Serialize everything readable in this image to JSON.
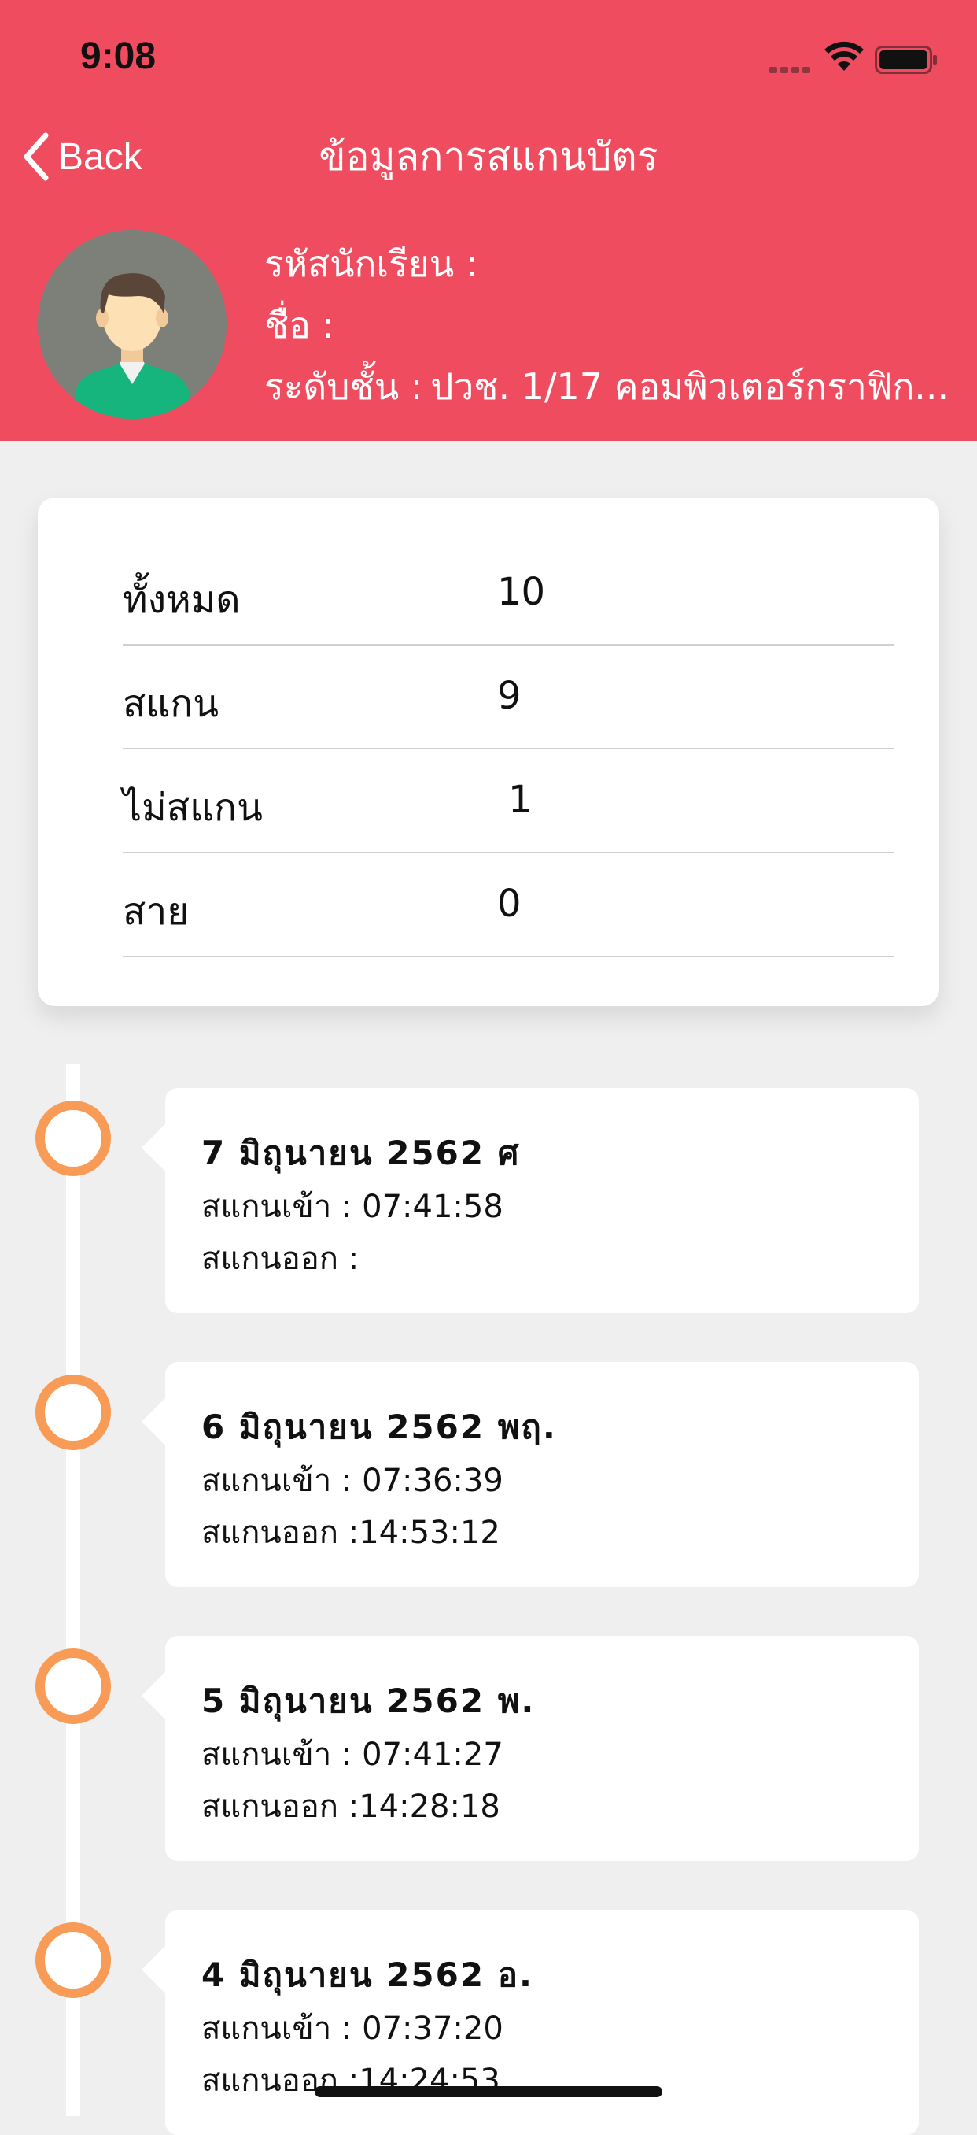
{
  "status_bar": {
    "time": "9:08"
  },
  "nav": {
    "back_label": "Back",
    "title": "ข้อมูลการสแกนบัตร"
  },
  "profile": {
    "student_id_label": "รหัสนักเรียน :",
    "student_id": "",
    "name_label": "ชื่อ :",
    "name": "",
    "level_label": "ระดับชั้น :",
    "level": "ปวช. 1/17 คอมพิวเตอร์กราฟิก..."
  },
  "summary": [
    {
      "label": "ทั้งหมด",
      "value": "10"
    },
    {
      "label": "สแกน",
      "value": "9"
    },
    {
      "label": "ไม่สแกน",
      "value": "1"
    },
    {
      "label": "สาย",
      "value": "0"
    }
  ],
  "entries": [
    {
      "date": "7 มิถุนายน 2562 ศ",
      "in": "สแกนเข้า : 07:41:58",
      "out": "สแกนออก :"
    },
    {
      "date": "6 มิถุนายน 2562 พฤ.",
      "in": "สแกนเข้า : 07:36:39",
      "out": "สแกนออก :14:53:12"
    },
    {
      "date": "5 มิถุนายน 2562 พ.",
      "in": "สแกนเข้า : 07:41:27",
      "out": "สแกนออก :14:28:18"
    },
    {
      "date": "4 มิถุนายน 2562 อ.",
      "in": "สแกนเข้า : 07:37:20",
      "out": "สแกนออก :14:24:53"
    }
  ],
  "colors": {
    "header": "#ef4d5f",
    "timeline_dot": "#f79b57",
    "background": "#efefef"
  }
}
